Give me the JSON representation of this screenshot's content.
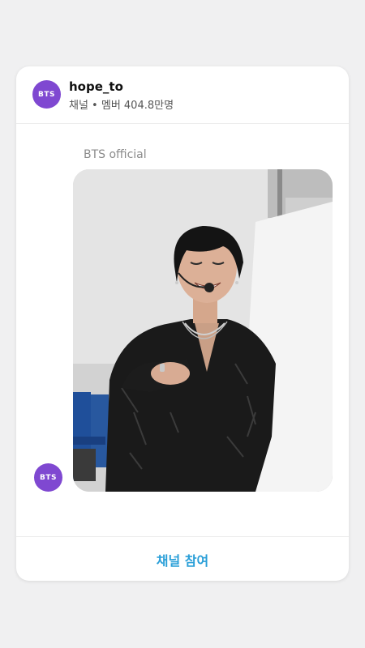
{
  "header": {
    "avatar_text": "BTS",
    "channel_name": "hope_to",
    "channel_meta": "채널 • 멤버 404.8만명"
  },
  "message": {
    "sender": "BTS official",
    "avatar_text": "BTS",
    "photo_description_icon": "photo-icon"
  },
  "footer": {
    "join_label": "채널 참여"
  },
  "colors": {
    "avatar": "#7f48d1",
    "accent": "#2a9fd8",
    "background": "#f0f0f1",
    "card": "#ffffff"
  }
}
